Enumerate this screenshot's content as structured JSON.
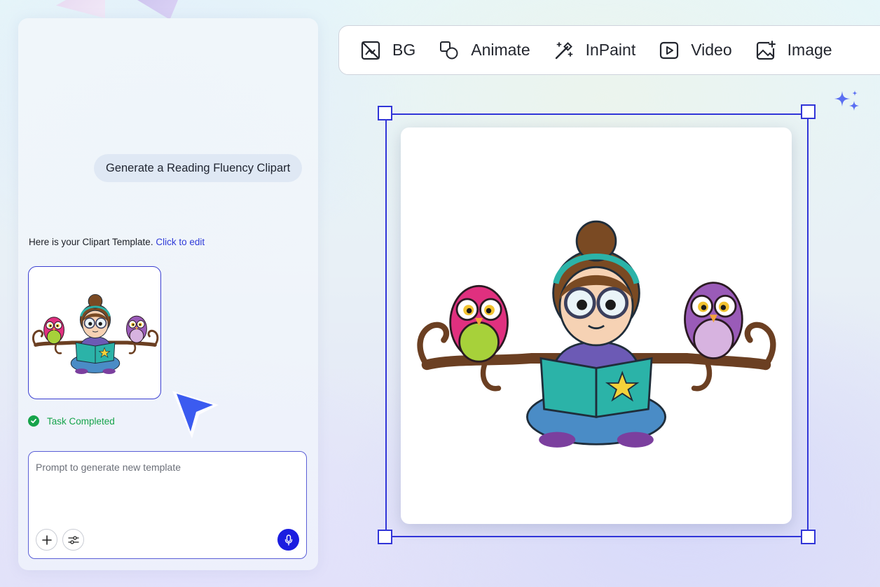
{
  "chat": {
    "user_message": "Generate a Reading Fluency Clipart",
    "bot_message": "Here is your Clipart Template.",
    "bot_link": "Click to edit",
    "status_text": "Task Completed",
    "prompt_placeholder": "Prompt to generate new template"
  },
  "toolbar": {
    "items": [
      {
        "label": "BG",
        "icon": "remove-background-icon"
      },
      {
        "label": "Animate",
        "icon": "animate-shapes-icon"
      },
      {
        "label": "InPaint",
        "icon": "magic-wand-icon"
      },
      {
        "label": "Video",
        "icon": "video-play-icon"
      },
      {
        "label": "Image",
        "icon": "image-add-icon"
      }
    ]
  },
  "canvas": {
    "artwork": "girl-reading-book-with-owls-clipart"
  },
  "colors": {
    "accent": "#3135d8",
    "success": "#16a34a",
    "link": "#2f3bd8",
    "mic": "#1b1de0"
  }
}
